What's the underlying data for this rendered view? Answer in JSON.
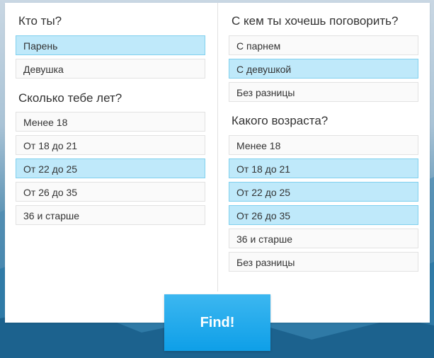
{
  "left": {
    "q1": {
      "title": "Кто ты?",
      "options": [
        "Парень",
        "Девушка"
      ],
      "selected": [
        0
      ]
    },
    "q2": {
      "title": "Сколько тебе лет?",
      "options": [
        "Менее 18",
        "От 18 до 21",
        "От 22 до 25",
        "От 26 до 35",
        "36 и старше"
      ],
      "selected": [
        2
      ]
    }
  },
  "right": {
    "q1": {
      "title": "С кем ты хочешь поговорить?",
      "options": [
        "С парнем",
        "С девушкой",
        "Без разницы"
      ],
      "selected": [
        1
      ]
    },
    "q2": {
      "title": "Какого возраста?",
      "options": [
        "Менее 18",
        "От 18 до 21",
        "От 22 до 25",
        "От 26 до 35",
        "36 и старше",
        "Без разницы"
      ],
      "selected": [
        1,
        2,
        3
      ]
    }
  },
  "find_button": {
    "label": "Find!"
  },
  "colors": {
    "selected_bg": "#bfe9fa",
    "selected_border": "#80d0ee",
    "button": "#0e9fe8"
  }
}
